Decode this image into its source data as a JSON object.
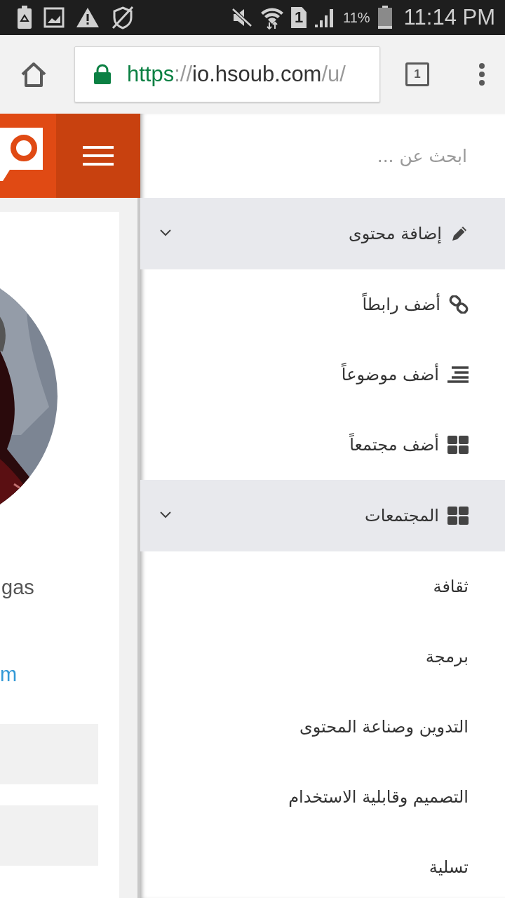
{
  "status_bar": {
    "sim_slot": "1",
    "battery_percent": "11%",
    "time": "11:14 PM"
  },
  "browser": {
    "url_scheme": "https",
    "url_separator": "://",
    "url_host": "io.hsoub.com",
    "url_path": "/u/",
    "tab_count": "1"
  },
  "page": {
    "name_fragment": "gas",
    "link_fragment": "m"
  },
  "drawer": {
    "search": {
      "placeholder": "ابحث عن ..."
    },
    "sections": [
      {
        "title": "إضافة محتوى",
        "kind": "pencil",
        "expanded": true,
        "items": [
          {
            "label": "أضف رابطاً",
            "kind": "link"
          },
          {
            "label": "أضف موضوعاً",
            "kind": "list"
          },
          {
            "label": "أضف مجتمعاً",
            "kind": "grid"
          }
        ]
      },
      {
        "title": "المجتمعات",
        "kind": "grid",
        "expanded": true,
        "items": [
          {
            "label": "ثقافة",
            "kind": "none"
          },
          {
            "label": "برمجة",
            "kind": "none"
          },
          {
            "label": "التدوين وصناعة المحتوى",
            "kind": "none"
          },
          {
            "label": "التصميم وقابلية الاستخدام",
            "kind": "none"
          },
          {
            "label": "تسلية",
            "kind": "none"
          }
        ]
      }
    ]
  }
}
